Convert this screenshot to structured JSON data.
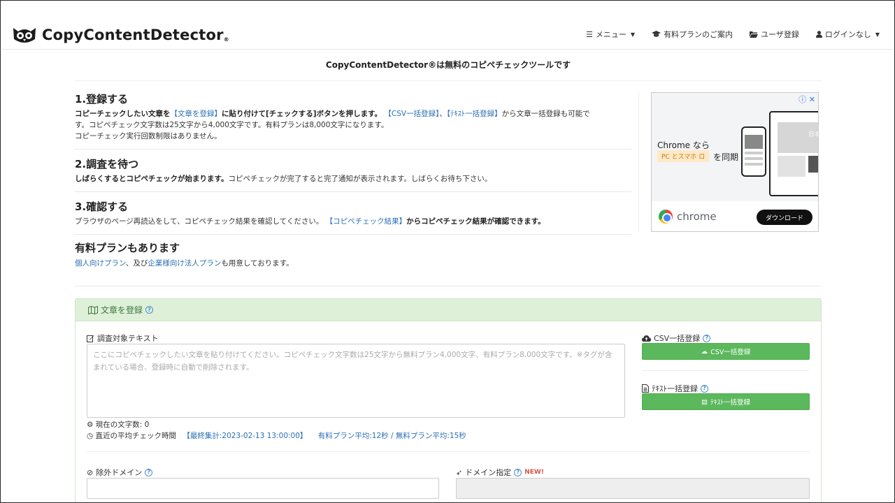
{
  "brand": {
    "name": "CopyContentDetector",
    "mark": "®"
  },
  "nav": {
    "menu": "メニュー",
    "paid": "有料プランのご案内",
    "register": "ユーザ登録",
    "login": "ログインなし"
  },
  "tagline": "CopyContentDetector®は無料のコピペチェックツールです",
  "steps": [
    {
      "title": "1.登録する",
      "line1_bold1": "コピーチェックしたい文章を",
      "line1_link1": "【文章を登録】",
      "line1_bold2": "に貼り付けて[チェックする]ボタンを押します。",
      "line1_link2": "【CSV一括登録】",
      "line1_sep": "、",
      "line1_link3": "【ﾃｷｽﾄ一括登録】",
      "line1_rest": "から文章一括登録も可能で",
      "line2": "す。コピペチェック文字数は25文字から4,000文字です。有料プランは8,000文字になります。",
      "line3": "コピーチェック実行回数制限はありません。"
    },
    {
      "title": "2.調査を待つ",
      "line1_bold": "しばらくするとコピペチェックが始まります。",
      "line1_rest": "コピペチェックが完了すると完了通知が表示されます。しばらくお待ち下さい。"
    },
    {
      "title": "3.確認する",
      "line1_text": "ブラウザのページ再読込をして、コピペチェック結果を確認してください。",
      "line1_link": "【コピペチェック結果】",
      "line1_bold": "からコピペチェック結果が確認できます。"
    }
  ],
  "plan": {
    "title": "有料プランもあります",
    "link1": "個人向けプラン",
    "text1": "、及び",
    "link2": "企業様向け法人プラン",
    "text2": "も用意しております。"
  },
  "ad": {
    "title": "Chrome なら",
    "pill": "PC とスマホ",
    "pill_icon": "ロ",
    "sync": "を同期",
    "brand": "chrome",
    "button": "ダウンロード",
    "laptop_text": "日本"
  },
  "panel": {
    "title": "文章を登録",
    "target_label": "調査対象テキスト",
    "target_placeholder": "ここにコピペチェックしたい文章を貼り付けてください。コピペチェック文字数は25文字から無料プラン4,000文字、有料プラン8,000文字です。※タグが含まれている場合、登録時に自動で削除されます。",
    "count_label": "現在の文字数:",
    "count_value": "0",
    "avg_label": "直近の平均チェック時間",
    "avg_updated": "【最終集計:2023-02-13 13:00:00】",
    "avg_values": "有料プラン平均:12秒 / 無料プラン平均:15秒",
    "csv_label": "CSV一括登録",
    "csv_button": "CSV一括登録",
    "text_label": "ﾃｷｽﾄ一括登録",
    "text_button": "ﾃｷｽﾄ一括登録",
    "exclude_label": "除外ドメイン",
    "domain_label": "ドメイン指定",
    "new_badge": "NEW!"
  },
  "colors": {
    "link": "#2a6fb5",
    "panel_head": "#dff0d8",
    "button": "#5cb85c"
  }
}
